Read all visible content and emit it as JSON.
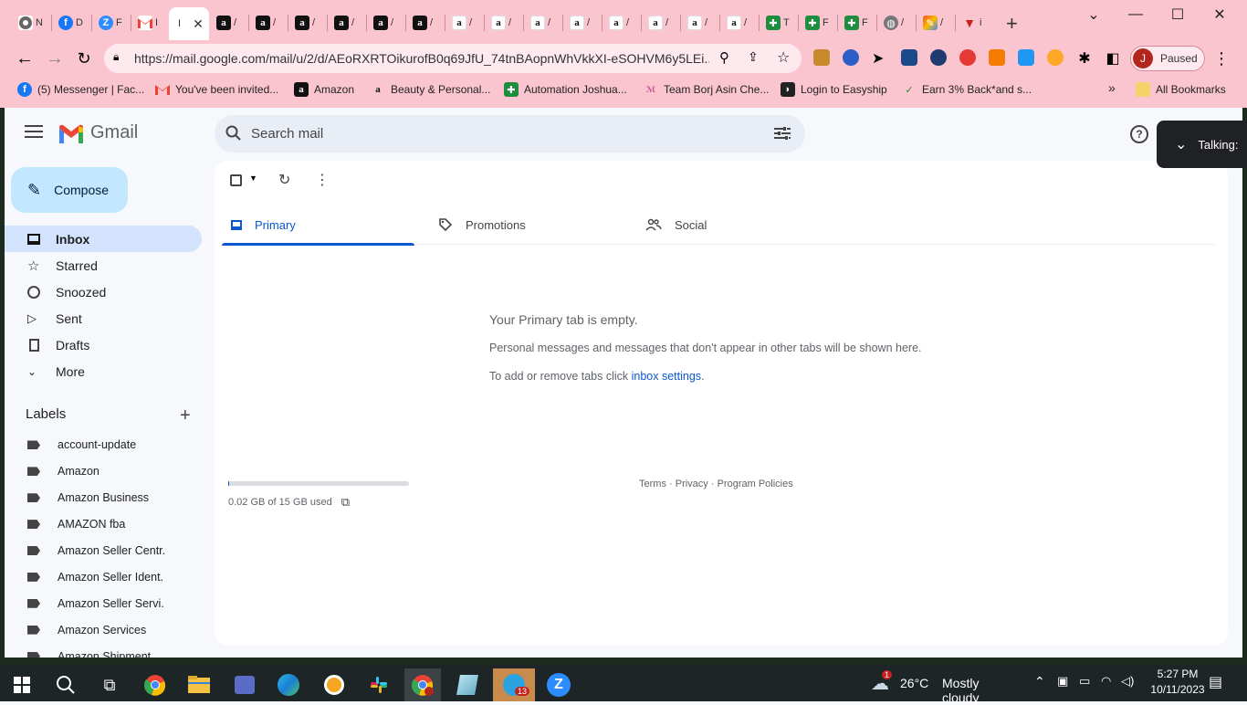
{
  "browser": {
    "tabs": [
      {
        "label": "N",
        "icon": "chrome-icon"
      },
      {
        "label": "D",
        "icon": "facebook-icon"
      },
      {
        "label": "F",
        "icon": "zoom-icon"
      },
      {
        "label": "I",
        "icon": "gmail-icon"
      },
      {
        "label": "I",
        "icon": "gmail-icon"
      },
      {
        "label": "/",
        "icon": "amazon-icon"
      },
      {
        "label": "/",
        "icon": "amazon-icon"
      },
      {
        "label": "/",
        "icon": "amazon-icon"
      },
      {
        "label": "/",
        "icon": "amazon-icon"
      },
      {
        "label": "/",
        "icon": "amazon-icon"
      },
      {
        "label": "/",
        "icon": "amazon-icon"
      },
      {
        "label": "/",
        "icon": "amazon-icon"
      },
      {
        "label": "/",
        "icon": "amazon-icon"
      },
      {
        "label": "/",
        "icon": "amazon-icon"
      },
      {
        "label": "/",
        "icon": "amazon-icon"
      },
      {
        "label": "/",
        "icon": "amazon-icon"
      },
      {
        "label": "/",
        "icon": "amazon-icon"
      },
      {
        "label": "/",
        "icon": "amazon-icon"
      },
      {
        "label": "/",
        "icon": "amazon-icon"
      },
      {
        "label": "T",
        "icon": "sheets-icon"
      },
      {
        "label": "F",
        "icon": "sheets-icon"
      },
      {
        "label": "F",
        "icon": "sheets-icon"
      },
      {
        "label": "/",
        "icon": "globe-icon"
      },
      {
        "label": "/",
        "icon": "pen-icon"
      },
      {
        "label": "i",
        "icon": "vpn-icon"
      }
    ],
    "new_tab": "+",
    "url": "https://mail.google.com/mail/u/2/d/AEoRXRTOikurofB0q69JfU_74tnBAopnWhVkkXI-eSOHVM6y5LEi...",
    "profile_label": "Paused",
    "profile_initial": "J",
    "bookmarks": [
      {
        "label": "(5) Messenger | Fac...",
        "icon": "facebook-icon"
      },
      {
        "label": "You've been invited...",
        "icon": "gmail-icon"
      },
      {
        "label": "Amazon",
        "icon": "amazon-icon"
      },
      {
        "label": "Beauty & Personal...",
        "icon": "amazon-icon"
      },
      {
        "label": "Automation Joshua...",
        "icon": "sheets-icon"
      },
      {
        "label": "Team Borj Asin Che...",
        "icon": "tbac-icon"
      },
      {
        "label": "Login to Easyship",
        "icon": "easyship-icon"
      },
      {
        "label": "Earn 3% Back*and s...",
        "icon": "rakuten-icon"
      }
    ],
    "more_bookmarks": "»",
    "all_bookmarks": "All Bookmarks"
  },
  "gmail": {
    "logo_text": "Gmail",
    "search_placeholder": "Search mail",
    "compose_label": "Compose",
    "nav": [
      {
        "label": "Inbox",
        "icon": "inbox-icon",
        "active": true
      },
      {
        "label": "Starred",
        "icon": "star-icon"
      },
      {
        "label": "Snoozed",
        "icon": "clock-icon"
      },
      {
        "label": "Sent",
        "icon": "send-icon"
      },
      {
        "label": "Drafts",
        "icon": "draft-icon"
      },
      {
        "label": "More",
        "icon": "chevron-down-icon"
      }
    ],
    "labels_title": "Labels",
    "labels": [
      "account-update",
      "Amazon",
      "Amazon Business",
      "AMAZON fba",
      "Amazon Seller Centr.",
      "Amazon Seller Ident.",
      "Amazon Seller Servi.",
      "Amazon Services",
      "Amazon Shipment"
    ],
    "tabs": [
      {
        "label": "Primary",
        "icon": "inbox-icon",
        "active": true
      },
      {
        "label": "Promotions",
        "icon": "tag-icon"
      },
      {
        "label": "Social",
        "icon": "people-icon"
      }
    ],
    "empty_title": "Your Primary tab is empty.",
    "empty_desc": "Personal messages and messages that don't appear in other tabs will be shown here.",
    "empty_tabs_prefix": "To add or remove tabs click ",
    "empty_tabs_link": "inbox settings",
    "empty_tabs_suffix": ".",
    "storage_text": "0.02 GB of 15 GB used",
    "storage_fraction": 0.0013,
    "footer_terms": "Terms",
    "footer_privacy": "Privacy",
    "footer_policies": "Program Policies",
    "footer_sep": " · ",
    "talking_label": "Talking:"
  },
  "taskbar": {
    "weather_temp": "26°C",
    "weather_desc": "Mostly cloudy",
    "weather_badge": "1",
    "time": "5:27 PM",
    "date": "10/11/2023",
    "app_badge": "13"
  },
  "colors": {
    "chrome_frame": "#fbc5d0",
    "gmail_accent": "#0b57d0",
    "nav_active": "#d3e3fd",
    "compose_bg": "#c2e7ff"
  }
}
